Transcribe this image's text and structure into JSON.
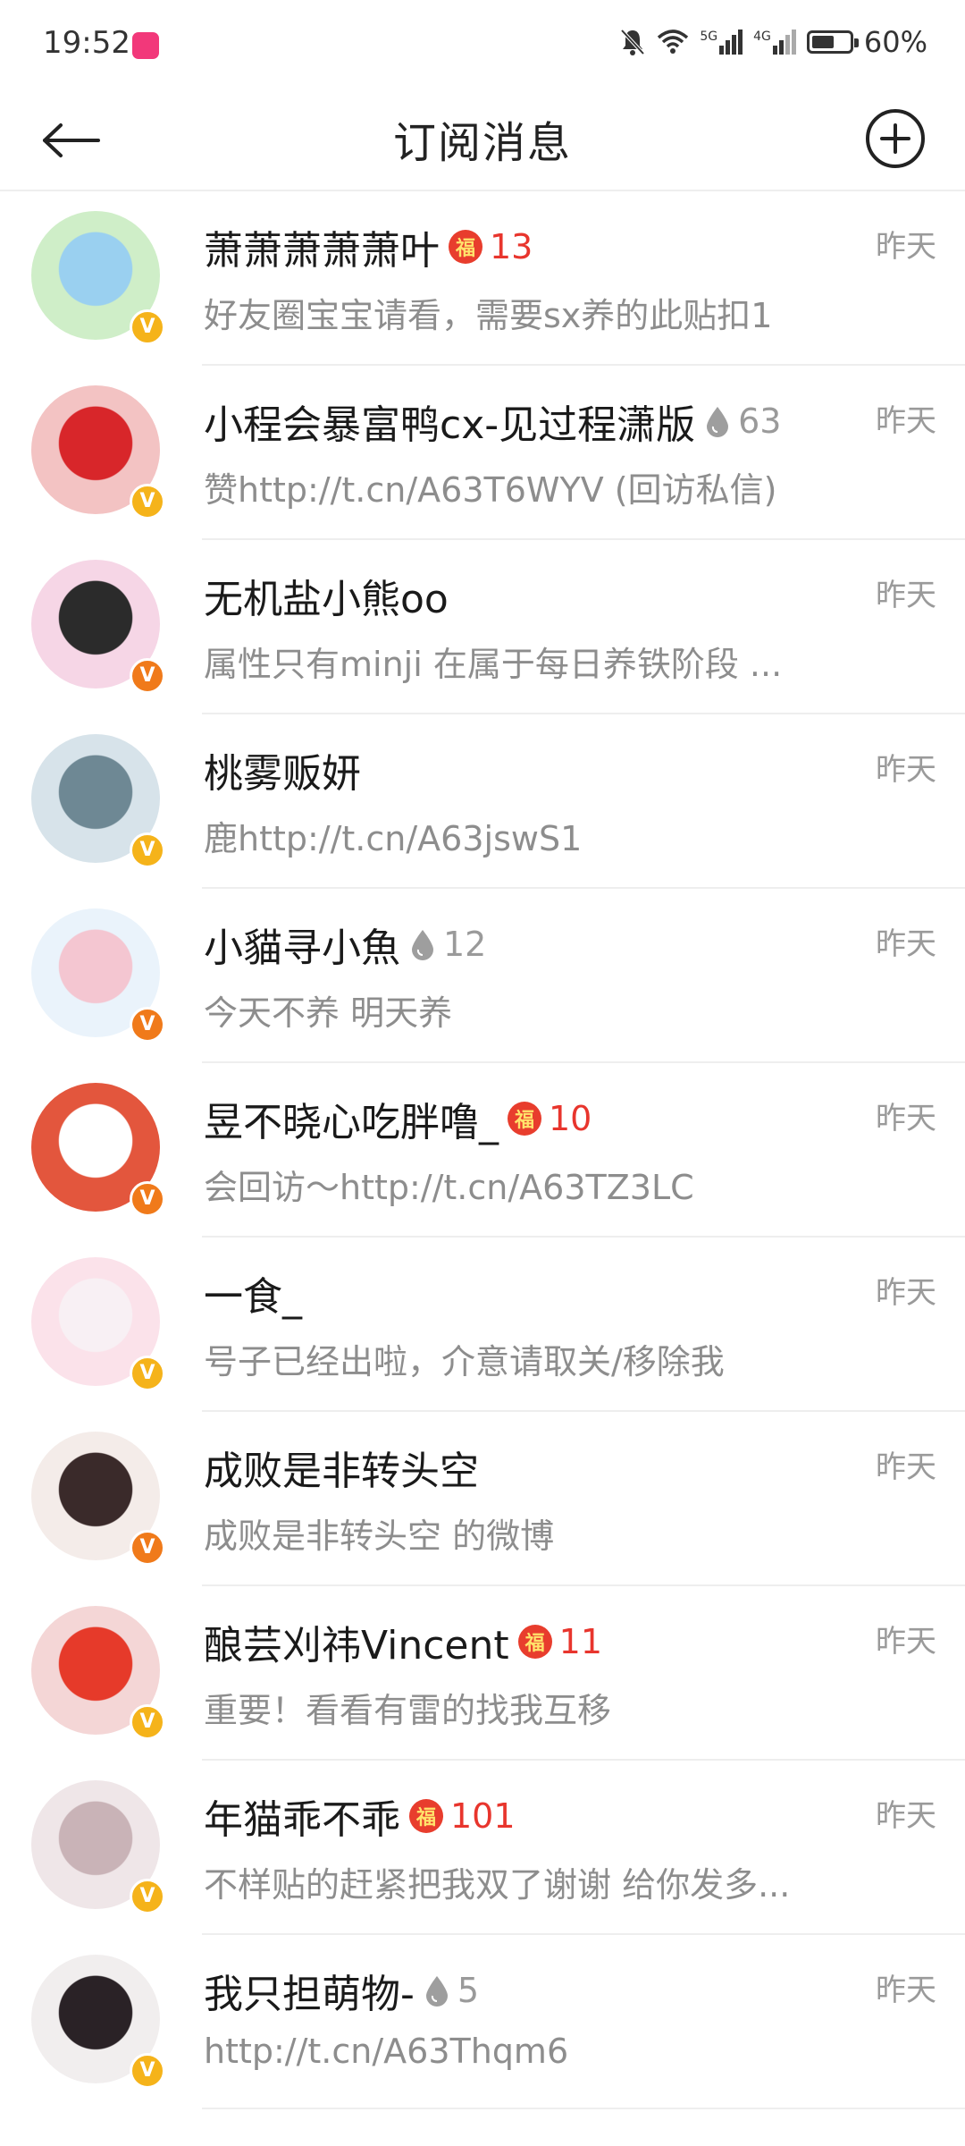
{
  "status_bar": {
    "time": "19:52",
    "network_5g": "5G",
    "network_4g": "4G",
    "battery": "60%",
    "battery_level": 0.6
  },
  "header": {
    "title": "订阅消息",
    "back_icon": "arrow-left-icon",
    "add_icon": "plus-circle-icon"
  },
  "colors": {
    "fortune_red": "#e8352d",
    "verified_gold": "#f5b31a",
    "verified_orange": "#f07a1a",
    "muted_text": "#8d8d8d"
  },
  "messages": [
    {
      "name": "萧萧萧萧萧叶",
      "badge": "fortune",
      "badge_num": "13",
      "message": "好友圈宝宝请看，需要sx养的此贴扣1",
      "time": "昨天",
      "verified": "gold"
    },
    {
      "name": "小程会暴富鸭cx-见过程潇版",
      "badge": "drop",
      "badge_num": "63",
      "message": "赞http://t.cn/A63T6WYV (回访私信)",
      "time": "昨天",
      "verified": "gold"
    },
    {
      "name": "无机盐小熊oo",
      "badge": "",
      "badge_num": "",
      "message": "属性只有minji 在属于每日养铁阶段 ...",
      "time": "昨天",
      "verified": "orange"
    },
    {
      "name": "桃雾贩妍",
      "badge": "",
      "badge_num": "",
      "message": "鹿http://t.cn/A63jswS1",
      "time": "昨天",
      "verified": "gold"
    },
    {
      "name": "小貓寻小魚",
      "badge": "drop",
      "badge_num": "12",
      "message": "今天不养 明天养",
      "time": "昨天",
      "verified": "orange"
    },
    {
      "name": "昱不晓心吃胖噜_",
      "badge": "fortune",
      "badge_num": "10",
      "message": "会回访～http://t.cn/A63TZ3LC",
      "time": "昨天",
      "verified": "orange"
    },
    {
      "name": "一食_",
      "badge": "",
      "badge_num": "",
      "message": "号子已经出啦，介意请取关/移除我",
      "time": "昨天",
      "verified": "gold"
    },
    {
      "name": "成败是非转头空",
      "badge": "",
      "badge_num": "",
      "message": "成败是非转头空 的微博",
      "time": "昨天",
      "verified": "orange"
    },
    {
      "name": "酿芸刈祎Vincent",
      "badge": "fortune",
      "badge_num": "11",
      "message": "重要！看看有雷的找我互移",
      "time": "昨天",
      "verified": "gold"
    },
    {
      "name": "年猫乖不乖",
      "badge": "fortune",
      "badge_num": "101",
      "message": "不样贴的赶紧把我双了谢谢 给你发多...",
      "time": "昨天",
      "verified": "gold"
    },
    {
      "name": "我只担萌物-",
      "badge": "drop",
      "badge_num": "5",
      "message": "http://t.cn/A63Thqm6",
      "time": "昨天",
      "verified": "gold"
    }
  ]
}
